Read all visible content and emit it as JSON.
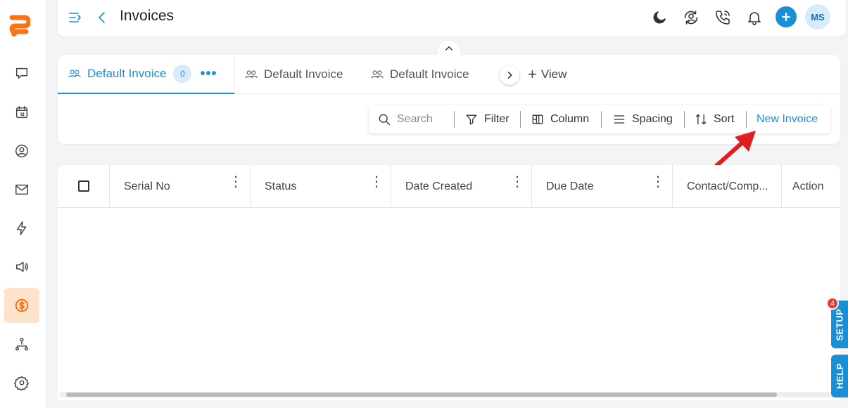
{
  "header": {
    "title": "Invoices",
    "avatar_initials": "MS"
  },
  "tabs": [
    {
      "label": "Default Invoice",
      "count": "0"
    },
    {
      "label": "Default Invoice"
    },
    {
      "label": "Default Invoice"
    }
  ],
  "add_view_label": "View",
  "toolbar": {
    "search_placeholder": "Search",
    "filter_label": "Filter",
    "column_label": "Column",
    "spacing_label": "Spacing",
    "sort_label": "Sort",
    "new_invoice_label": "New Invoice"
  },
  "table": {
    "columns": [
      "Serial No",
      "Status",
      "Date Created",
      "Due Date",
      "Contact/Comp...",
      "Action"
    ]
  },
  "side_tabs": {
    "setup_label": "SETUP",
    "setup_badge": "4",
    "help_label": "HELP"
  },
  "colors": {
    "accent": "#1a8fd6",
    "brand": "#f97316",
    "annotation_arrow": "#e11d1d"
  }
}
